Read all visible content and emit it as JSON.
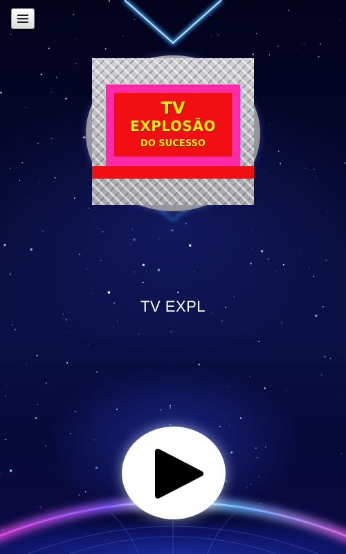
{
  "header": {
    "menu_icon": "hamburger-menu-icon"
  },
  "logo": {
    "line1": "TV",
    "line2": "EXPLOSÃO",
    "line3": "DO SUCESSO",
    "colors": {
      "frame": "#ff2aa8",
      "panel": "#f20f14",
      "text": "#ffe419",
      "plate": "#b7b7bc"
    }
  },
  "player": {
    "station_name": "TV EXPL",
    "play_icon": "play-icon",
    "state": "stopped"
  },
  "theme": {
    "background": "#02021a",
    "accent": "#3fa9ff"
  }
}
